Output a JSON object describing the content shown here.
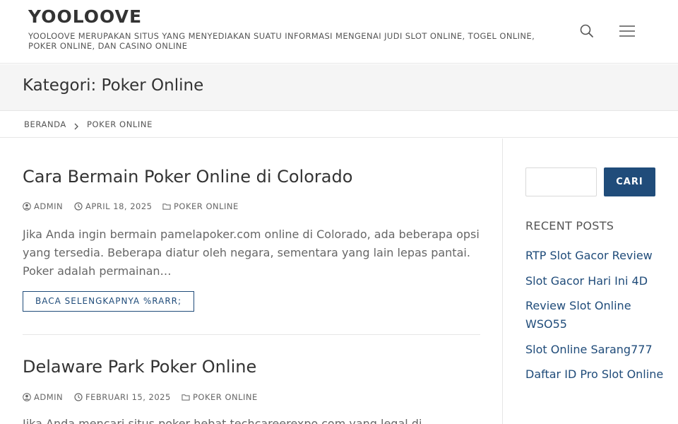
{
  "header": {
    "site_title": "YOOLOOVE",
    "site_description": "YOOLOOVE MERUPAKAN SITUS YANG MENYEDIAKAN SUATU INFORMASI MENGENAI JUDI SLOT ONLINE, TOGEL ONLINE, POKER ONLINE, DAN CASINO ONLINE",
    "icons": [
      "search-icon",
      "menu-icon"
    ]
  },
  "page_header": {
    "title": "Kategori: Poker Online"
  },
  "breadcrumb": {
    "home": "BERANDA",
    "current": "POKER ONLINE"
  },
  "posts": [
    {
      "title": "Cara Bermain Poker Online di Colorado",
      "author": "ADMIN",
      "date": "APRIL 18, 2025",
      "category": "POKER ONLINE",
      "excerpt": "Jika Anda ingin bermain pamelapoker.com online di Colorado, ada beberapa opsi yang tersedia. Beberapa diatur oleh negara, sementara yang lain lepas pantai. Poker adalah permainan…",
      "read_more": "BACA SELENGKAPNYA %RARR;"
    },
    {
      "title": "Delaware Park Poker Online",
      "author": "ADMIN",
      "date": "FEBRUARI 15, 2025",
      "category": "POKER ONLINE",
      "excerpt": "Jika Anda mencari situs poker hebat techcareerexpo.com yang legal di"
    }
  ],
  "sidebar": {
    "search_button": "CARI",
    "search_placeholder": "",
    "recent_posts_title": "RECENT POSTS",
    "recent_posts": [
      "RTP Slot Gacor Review",
      "Slot Gacor Hari Ini 4D",
      "Review Slot Online WSO55",
      "Slot Online Sarang777",
      "Daftar ID Pro Slot Online"
    ]
  },
  "colors": {
    "accent": "#204c7a",
    "page_header_bg": "#f5f5f5",
    "text": "#333333",
    "muted_text": "#666666"
  }
}
